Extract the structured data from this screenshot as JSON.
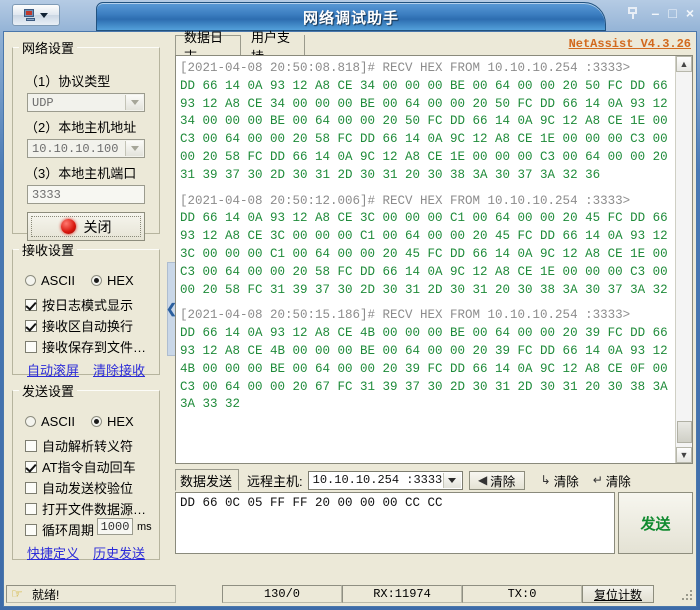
{
  "window": {
    "title": "网络调试助手",
    "controls": {
      "pin": "pin-icon",
      "minimize": "–",
      "maximize": "□",
      "close": "×"
    }
  },
  "left_panel": {
    "network_settings": {
      "legend": "网络设置",
      "protocol_label": "（1）协议类型",
      "protocol_value": "UDP",
      "local_host_label": "（2）本地主机地址",
      "local_host_value": "10.10.10.100",
      "local_port_label": "（3）本地主机端口",
      "local_port_value": "3333",
      "action_button": "关闭"
    },
    "recv_settings": {
      "legend": "接收设置",
      "mode_ascii": "ASCII",
      "mode_hex": "HEX",
      "mode_selected": "HEX",
      "checkboxes": [
        {
          "label": "按日志模式显示",
          "checked": true
        },
        {
          "label": "接收区自动换行",
          "checked": true
        },
        {
          "label": "接收保存到文件…",
          "checked": false
        }
      ],
      "links": [
        "自动滚屏",
        "清除接收"
      ]
    },
    "send_settings": {
      "legend": "发送设置",
      "mode_ascii": "ASCII",
      "mode_hex": "HEX",
      "mode_selected": "HEX",
      "checkboxes": [
        {
          "label": "自动解析转义符",
          "checked": false
        },
        {
          "label": "AT指令自动回车",
          "checked": true
        },
        {
          "label": "自动发送校验位",
          "checked": false
        },
        {
          "label": "打开文件数据源…",
          "checked": false
        }
      ],
      "cycle": {
        "label": "循环周期",
        "checked": false,
        "value": "1000",
        "unit": "ms"
      },
      "links": [
        "快捷定义",
        "历史发送"
      ]
    }
  },
  "right_panel": {
    "tabs": [
      {
        "label": "数据日志",
        "active": true
      },
      {
        "label": "用户支持",
        "active": false
      }
    ],
    "version": "NetAssist V4.3.26",
    "log_blocks": [
      {
        "header": "[2021-04-08 20:50:08.818]# RECV HEX FROM 10.10.10.254 :3333>",
        "lines": [
          "DD 66 14 0A 93 12 A8 CE 34 00 00 00 BE 00 64 00 00 20 50 FC DD 66 14 0A",
          "93 12 A8 CE 34 00 00 00 BE 00 64 00 00 20 50 FC DD 66 14 0A 93 12 A8 CE",
          "34 00 00 00 BE 00 64 00 00 20 50 FC DD 66 14 0A 9C 12 A8 CE 1E 00 00 00",
          "C3 00 64 00 00 20 58 FC DD 66 14 0A 9C 12 A8 CE 1E 00 00 00 C3 00 64 00",
          "00 20 58 FC DD 66 14 0A 9C 12 A8 CE 1E 00 00 00 C3 00 64 00 00 20 58 FC",
          "31 39 37 30 2D 30 31 2D 30 31 20 30 38 3A 30 37 3A 32 36"
        ]
      },
      {
        "header": "[2021-04-08 20:50:12.006]# RECV HEX FROM 10.10.10.254 :3333>",
        "lines": [
          "DD 66 14 0A 93 12 A8 CE 3C 00 00 00 C1 00 64 00 00 20 45 FC DD 66 14 0A",
          "93 12 A8 CE 3C 00 00 00 C1 00 64 00 00 20 45 FC DD 66 14 0A 93 12 A8 CE",
          "3C 00 00 00 C1 00 64 00 00 20 45 FC DD 66 14 0A 9C 12 A8 CE 1E 00 00 00",
          "C3 00 64 00 00 20 58 FC DD 66 14 0A 9C 12 A8 CE 1E 00 00 00 C3 00 64 00",
          "00 20 58 FC 31 39 37 30 2D 30 31 2D 30 31 20 30 38 3A 30 37 3A 32 39"
        ]
      },
      {
        "header": "[2021-04-08 20:50:15.186]# RECV HEX FROM 10.10.10.254 :3333>",
        "lines": [
          "DD 66 14 0A 93 12 A8 CE 4B 00 00 00 BE 00 64 00 00 20 39 FC DD 66 14 0A",
          "93 12 A8 CE 4B 00 00 00 BE 00 64 00 00 20 39 FC DD 66 14 0A 93 12 A8 CE",
          "4B 00 00 00 BE 00 64 00 00 20 39 FC DD 66 14 0A 9C 12 A8 CE 0F 00 00 00",
          "C3 00 64 00 00 20 67 FC 31 39 37 30 2D 30 31 2D 30 31 20 30 38 3A 30 37",
          "3A 33 32"
        ]
      }
    ],
    "send_bar": {
      "tab_label": "数据发送",
      "remote_label": "远程主机:",
      "remote_value": "10.10.10.254 :3333",
      "clear_button": "清除",
      "clear_recv_button": "清除",
      "clear_send_button": "清除"
    },
    "send_input_value": "DD 66 0C 05 FF FF 20 00 00 00 CC CC",
    "send_button": "发送"
  },
  "status_bar": {
    "ready_text": "就绪!",
    "counter": "130/0",
    "rx": "RX:11974",
    "tx": "TX:0",
    "reset_button": "复位计数"
  },
  "colors": {
    "accent": "#3d7fc2",
    "log_data": "#1f8b3a",
    "log_header": "#8c8c8c",
    "version": "#d2691e",
    "link": "#2b2bd8",
    "send_label": "#108a2f"
  }
}
